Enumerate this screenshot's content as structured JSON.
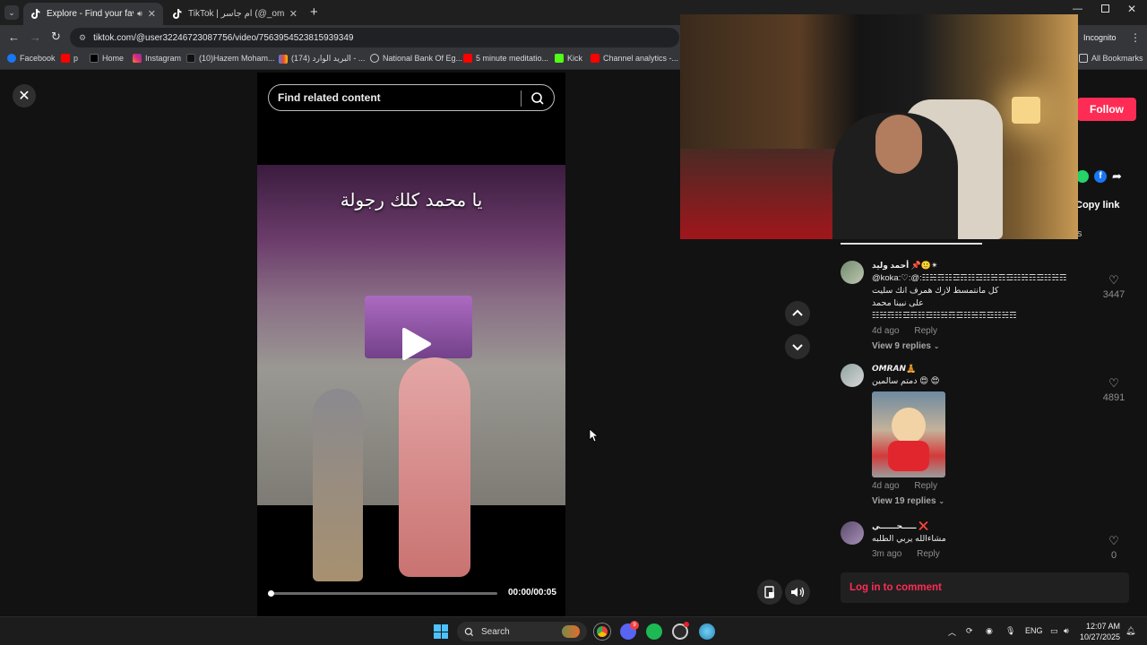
{
  "browser": {
    "tabs": [
      {
        "title": "Explore - Find your favourite",
        "active": true
      },
      {
        "title": "TikTok | ام جاسر (@_omgaser)",
        "active": false
      }
    ],
    "new_tab": "+",
    "url": "tiktok.com/@user32246723087756/video/7563954523815939349",
    "profile_label": "Incognito",
    "bookmarks": [
      "Facebook",
      "p",
      "Home",
      "Instagram",
      "(10)Hazem Moham...",
      "(174) البريد الوارد - ...",
      "National Bank Of Eg...",
      "5 minute meditatio...",
      "Kick",
      "Channel analytics -..."
    ],
    "all_bookmarks": "All Bookmarks"
  },
  "video": {
    "search_placeholder": "Find related content",
    "caption": "يا محمد كلك رجولة",
    "time": "00:00/00:05",
    "progress": 0.0
  },
  "right_panel": {
    "follow_label": "Follow",
    "copy_link": "Copy link",
    "tab_partial": "s",
    "comments": [
      {
        "name": "أحمد وليد 📌🙂✴",
        "lines": [
          "@koka:♡:@:☷☵☶☷☲☶☷☲☷☵☶☲☷☵☶☲☷☵☶",
          "كل مانتمسط لازك همرف انك سليت",
          "على نبينا محمد",
          "☷☵☶☷☲☶☷☲☷☵☶☲☷☵☶☲☷☵☶"
        ],
        "time": "4d ago",
        "reply": "Reply",
        "likes": "3447",
        "view_replies": "View 9 replies"
      },
      {
        "name": "𝙊𝙈𝙍𝘼𝙉🧘",
        "lines": [
          "😍 😍 دمتم سالمين"
        ],
        "time": "4d ago",
        "reply": "Reply",
        "likes": "4891",
        "view_replies": "View 19 replies"
      },
      {
        "name": "ـــــحــــــي ❌",
        "lines": [
          "مشاءالله يربي الطلبه"
        ],
        "time": "3m ago",
        "reply": "Reply",
        "likes": "0"
      }
    ],
    "login_prompt": "Log in to comment"
  },
  "taskbar": {
    "search_label": "Search",
    "lang": "ENG",
    "time": "12:07 AM",
    "date": "10/27/2025",
    "discord_badge": "9"
  },
  "colors": {
    "accent": "#fe2c55",
    "page_bg": "#121212",
    "chrome_bg": "#35363a"
  }
}
